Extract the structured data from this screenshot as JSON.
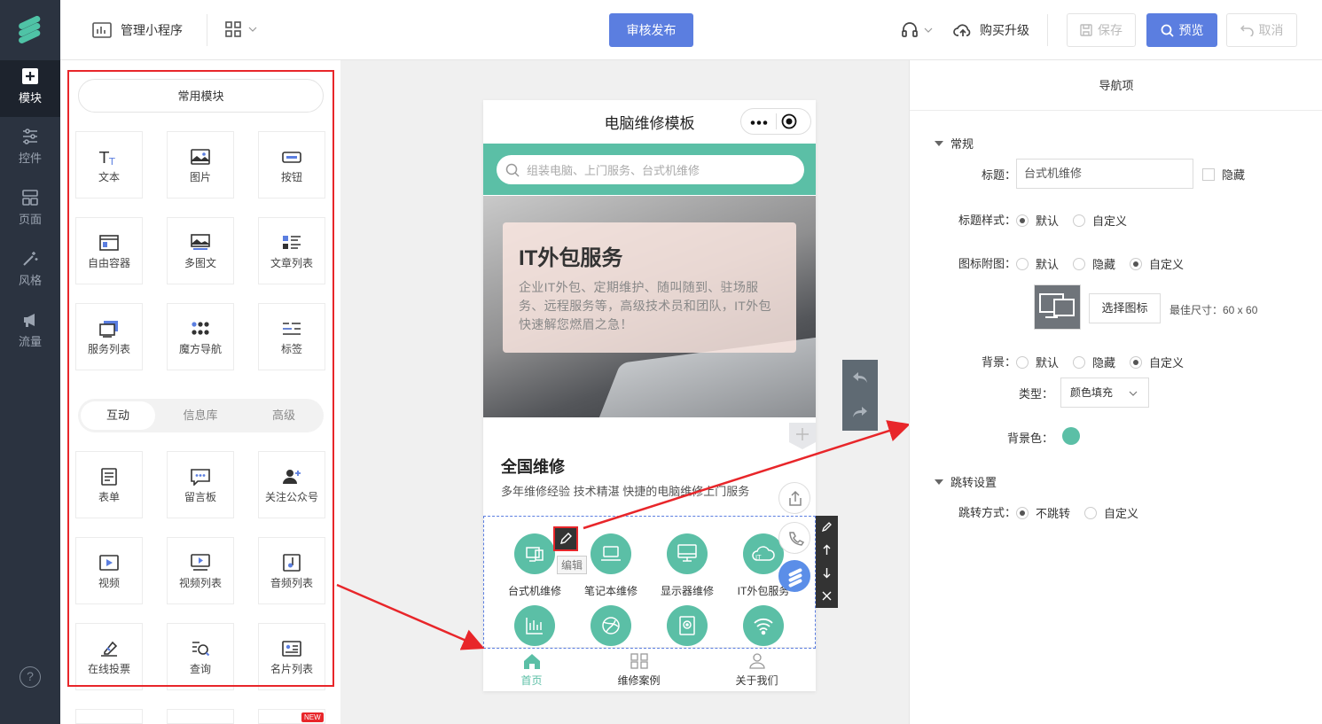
{
  "rail": {
    "items": [
      {
        "label": "模块",
        "icon": "plus-square-icon",
        "active": true
      },
      {
        "label": "控件",
        "icon": "sliders-icon"
      },
      {
        "label": "页面",
        "icon": "layers-icon"
      },
      {
        "label": "风格",
        "icon": "magic-wand-icon"
      },
      {
        "label": "流量",
        "icon": "megaphone-icon"
      }
    ],
    "help": "?"
  },
  "topbar": {
    "manage_label": "管理小程序",
    "publish_label": "审核发布",
    "upgrade_label": "购买升级",
    "save_label": "保存",
    "preview_label": "预览",
    "cancel_label": "取消"
  },
  "modules": {
    "common_tab": "常用模块",
    "common": [
      {
        "label": "文本",
        "icon": "text-icon"
      },
      {
        "label": "图片",
        "icon": "image-icon"
      },
      {
        "label": "按钮",
        "icon": "button-icon"
      },
      {
        "label": "自由容器",
        "icon": "container-icon"
      },
      {
        "label": "多图文",
        "icon": "multi-image-icon"
      },
      {
        "label": "文章列表",
        "icon": "article-list-icon"
      },
      {
        "label": "服务列表",
        "icon": "service-list-icon"
      },
      {
        "label": "魔方导航",
        "icon": "grid-nav-icon"
      },
      {
        "label": "标签",
        "icon": "tag-icon"
      }
    ],
    "seg_tabs": [
      "互动",
      "信息库",
      "高级"
    ],
    "interactive": [
      {
        "label": "表单",
        "icon": "form-icon"
      },
      {
        "label": "留言板",
        "icon": "message-board-icon"
      },
      {
        "label": "关注公众号",
        "icon": "follow-icon"
      },
      {
        "label": "视频",
        "icon": "video-icon"
      },
      {
        "label": "视频列表",
        "icon": "video-list-icon"
      },
      {
        "label": "音频列表",
        "icon": "audio-list-icon"
      },
      {
        "label": "在线投票",
        "icon": "vote-icon"
      },
      {
        "label": "查询",
        "icon": "query-icon"
      },
      {
        "label": "名片列表",
        "icon": "card-list-icon"
      }
    ],
    "new_badge": "NEW"
  },
  "phone": {
    "title": "电脑维修模板",
    "search_placeholder": "组装电脑、上门服务、台式机维修",
    "banner_title": "IT外包服务",
    "banner_desc": "企业IT外包、定期维护、随叫随到、驻场服务、远程服务等，高级技术员和团队，IT外包快速解您燃眉之急！",
    "section_title": "全国维修",
    "section_desc": "多年维修经验 技术精湛 快捷的电脑维修上门服务",
    "nav_items": [
      {
        "label": "台式机维修",
        "icon": "desktop-icon"
      },
      {
        "label": "笔记本维修",
        "icon": "laptop-icon"
      },
      {
        "label": "显示器维修",
        "icon": "monitor-icon"
      },
      {
        "label": "IT外包服务",
        "icon": "cloud-icon"
      },
      {
        "label": "",
        "icon": "chart-icon"
      },
      {
        "label": "",
        "icon": "globe-icon"
      },
      {
        "label": "",
        "icon": "harddisk-icon"
      },
      {
        "label": "",
        "icon": "wifi-icon"
      }
    ],
    "edit_tip": "编辑",
    "tabs": [
      {
        "label": "首页",
        "icon": "home-icon",
        "active": true
      },
      {
        "label": "维修案例",
        "icon": "grid-icon"
      },
      {
        "label": "关于我们",
        "icon": "user-icon"
      }
    ]
  },
  "props": {
    "header": "导航项",
    "general_section": "常规",
    "title_label": "标题：",
    "title_value": "台式机维修",
    "hide_label": "隐藏",
    "title_style_label": "标题样式：",
    "title_style_options": [
      "默认",
      "自定义"
    ],
    "icon_image_label": "图标附图：",
    "icon_image_options": [
      "默认",
      "隐藏",
      "自定义"
    ],
    "choose_icon_label": "选择图标",
    "size_hint": "最佳尺寸：60 x 60",
    "bg_label": "背景：",
    "bg_options": [
      "默认",
      "隐藏",
      "自定义"
    ],
    "type_label": "类型：",
    "type_value": "颜色填充",
    "bg_color_label": "背景色：",
    "bg_color": "#5bbfa6",
    "jump_section": "跳转设置",
    "jump_label": "跳转方式：",
    "jump_options": [
      "不跳转",
      "自定义"
    ]
  },
  "colors": {
    "accent": "#5b7ee0",
    "brand": "#5bbfa6",
    "highlight": "#e8262a"
  }
}
